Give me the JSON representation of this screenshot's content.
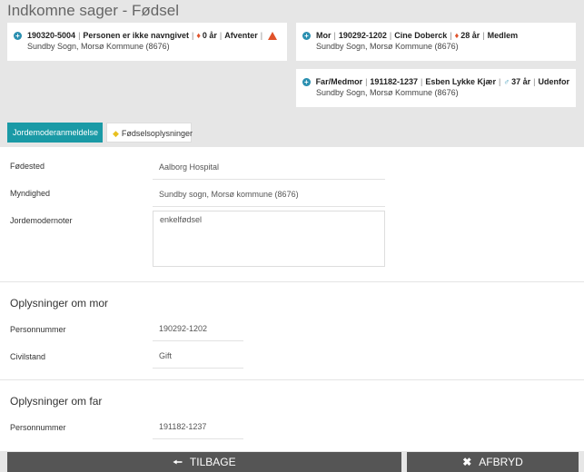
{
  "header": {
    "title": "Indkomne sager - Fødsel"
  },
  "child_card": {
    "cpr": "190320-5004",
    "name": "Personen er ikke navngivet",
    "age": "0 år",
    "status": "Afventer",
    "location": "Sundby Sogn, Morsø Kommune (8676)"
  },
  "mother_card": {
    "role": "Mor",
    "cpr": "190292-1202",
    "name": "Cine Doberck",
    "age": "28 år",
    "status": "Medlem",
    "location": "Sundby Sogn, Morsø Kommune (8676)"
  },
  "father_card": {
    "role": "Far/Medmor",
    "cpr": "191182-1237",
    "name": "Esben Lykke Kjær",
    "age": "37 år",
    "status": "Udenfor",
    "location": "Sundby Sogn, Morsø Kommune (8676)"
  },
  "tabs": [
    {
      "label": "Jordemoderanmeldelse"
    },
    {
      "label": "Fødselsoplysninger"
    }
  ],
  "birth": {
    "place_label": "Fødested",
    "place_value": "Aalborg Hospital",
    "authority_label": "Myndighed",
    "authority_value": "Sundby sogn, Morsø kommune (8676)",
    "notes_label": "Jordemodernoter",
    "notes_value": "enkelfødsel"
  },
  "mother_info": {
    "title": "Oplysninger om mor",
    "cpr_label": "Personnummer",
    "cpr_value": "190292-1202",
    "civil_label": "Civilstand",
    "civil_value": "Gift"
  },
  "father_info": {
    "title": "Oplysninger om far",
    "cpr_label": "Personnummer",
    "cpr_value": "191182-1237"
  },
  "footer": {
    "back_label": "TILBAGE",
    "cancel_label": "AFBRYD"
  },
  "colors": {
    "accent": "#1a9aa6",
    "icon_blue": "#2a8fb0",
    "female": "#e0522a",
    "button_bg": "#555555"
  }
}
